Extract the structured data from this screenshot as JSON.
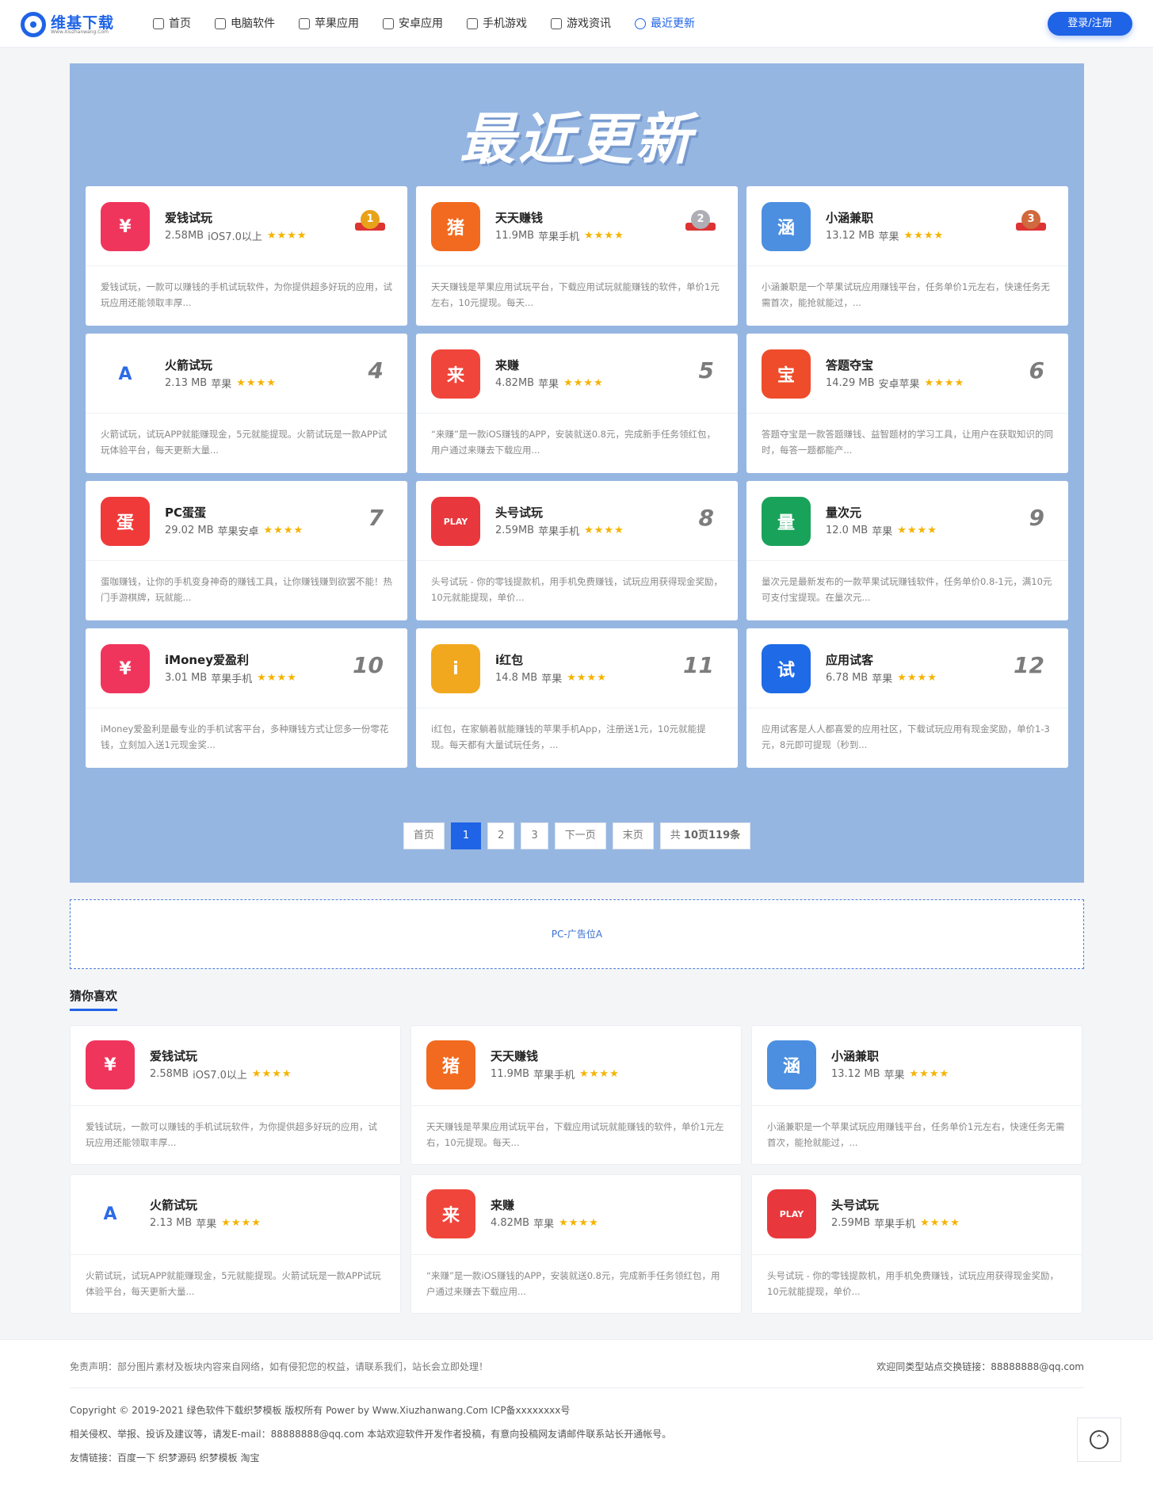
{
  "header": {
    "logo_text": "维基下载",
    "logo_sub": "Www.Xiuzhanwang.Com",
    "nav": [
      {
        "label": "首页",
        "icon": "home-icon"
      },
      {
        "label": "电脑软件",
        "icon": "software-icon"
      },
      {
        "label": "苹果应用",
        "icon": "apple-icon"
      },
      {
        "label": "安卓应用",
        "icon": "android-icon"
      },
      {
        "label": "手机游戏",
        "icon": "game-icon"
      },
      {
        "label": "游戏资讯",
        "icon": "news-icon"
      },
      {
        "label": "最近更新",
        "icon": "update-icon"
      }
    ],
    "login": "登录/注册"
  },
  "hero": {
    "title": "最近更新",
    "cards": [
      {
        "name": "爱钱试玩",
        "size": "2.58MB",
        "platform": "iOS7.0以上",
        "rank": "1",
        "medal": "GOLD",
        "desc": "爱钱试玩，一款可以赚钱的手机试玩软件，为你提供超多好玩的应用，试玩应用还能领取丰厚...",
        "icon_text": "¥",
        "icon_bg": "#f0355d"
      },
      {
        "name": "天天赚钱",
        "size": "11.9MB",
        "platform": "苹果手机",
        "rank": "2",
        "medal": "SILVER",
        "desc": "天天赚钱是苹果应用试玩平台，下载应用试玩就能赚钱的软件，单价1元左右，10元提现。每天...",
        "icon_text": "猪",
        "icon_bg": "#f26a1f"
      },
      {
        "name": "小涵兼职",
        "size": "13.12 MB",
        "platform": "苹果",
        "rank": "3",
        "medal": "BRONZE",
        "desc": "小涵兼职是一个苹果试玩应用赚钱平台，任务单价1元左右，快速任务无需首次，能抢就能过，...",
        "icon_text": "涵",
        "icon_bg": "#4c8fe0"
      },
      {
        "name": "火箭试玩",
        "size": "2.13 MB",
        "platform": "苹果",
        "rank": "4",
        "medal": "",
        "desc": "火箭试玩，试玩APP就能赚现金，5元就能提现。火箭试玩是一款APP试玩体验平台，每天更新大量...",
        "icon_text": "A",
        "icon_bg": "#ffffff"
      },
      {
        "name": "来赚",
        "size": "4.82MB",
        "platform": "苹果",
        "rank": "5",
        "medal": "",
        "desc": "“来赚”是一款iOS赚钱的APP，安装就送0.8元，完成新手任务领红包，用户通过来赚去下载应用...",
        "icon_text": "来",
        "icon_bg": "#f0453b"
      },
      {
        "name": "答题夺宝",
        "size": "14.29 MB",
        "platform": "安卓苹果",
        "rank": "6",
        "medal": "",
        "desc": "答题夺宝是一款答题赚钱、益智题材的学习工具，让用户在获取知识的同时，每答一题都能产...",
        "icon_text": "宝",
        "icon_bg": "#ee4c2a"
      },
      {
        "name": "PC蛋蛋",
        "size": "29.02 MB",
        "platform": "苹果安卓",
        "rank": "7",
        "medal": "",
        "desc": "蛋咖赚钱，让你的手机变身神奇的赚钱工具，让你赚钱赚到欲罢不能！热门手游棋牌，玩就能...",
        "icon_text": "蛋",
        "icon_bg": "#f03a3a"
      },
      {
        "name": "头号试玩",
        "size": "2.59MB",
        "platform": "苹果手机",
        "rank": "8",
        "medal": "",
        "desc": "头号试玩 - 你的零钱提款机，用手机免费赚钱，试玩应用获得现金奖励，10元就能提现，单价...",
        "icon_text": "PLAY",
        "icon_bg": "#e8383d"
      },
      {
        "name": "量次元",
        "size": "12.0 MB",
        "platform": "苹果",
        "rank": "9",
        "medal": "",
        "desc": "量次元是最新发布的一款苹果试玩赚钱软件，任务单价0.8-1元，满10元可支付宝提现。在量次元...",
        "icon_text": "量",
        "icon_bg": "#19a35a"
      },
      {
        "name": "iMoney爱盈利",
        "size": "3.01 MB",
        "platform": "苹果手机",
        "rank": "10",
        "medal": "",
        "desc": "iMoney爱盈利是最专业的手机试客平台，多种赚钱方式让您多一份零花钱，立刻加入送1元现金奖...",
        "icon_text": "¥",
        "icon_bg": "#f0355d"
      },
      {
        "name": "i红包",
        "size": "14.8 MB",
        "platform": "苹果",
        "rank": "11",
        "medal": "",
        "desc": "i红包，在家躺着就能赚钱的苹果手机App，注册送1元，10元就能提现。每天都有大量试玩任务，...",
        "icon_text": "i",
        "icon_bg": "#f2a81e"
      },
      {
        "name": "应用试客",
        "size": "6.78 MB",
        "platform": "苹果",
        "rank": "12",
        "medal": "",
        "desc": "应用试客是人人都喜爱的应用社区，下载试玩应用有现金奖励，单价1-3元，8元即可提现（秒到...",
        "icon_text": "试",
        "icon_bg": "#1f6ae6"
      }
    ]
  },
  "pager": {
    "first": "首页",
    "pages": [
      "1",
      "2",
      "3"
    ],
    "next": "下一页",
    "last": "末页",
    "total_prefix": "共",
    "total_pages": "10页",
    "total_count": "119条"
  },
  "ad": {
    "label": "PC-广告位A"
  },
  "guess": {
    "title": "猜你喜欢",
    "cards": [
      {
        "name": "爱钱试玩",
        "size": "2.58MB",
        "platform": "iOS7.0以上",
        "desc": "爱钱试玩，一款可以赚钱的手机试玩软件，为你提供超多好玩的应用，试玩应用还能领取丰厚...",
        "icon_text": "¥",
        "icon_bg": "#f0355d"
      },
      {
        "name": "天天赚钱",
        "size": "11.9MB",
        "platform": "苹果手机",
        "desc": "天天赚钱是苹果应用试玩平台，下载应用试玩就能赚钱的软件，单价1元左右，10元提现。每天...",
        "icon_text": "猪",
        "icon_bg": "#f26a1f"
      },
      {
        "name": "小涵兼职",
        "size": "13.12 MB",
        "platform": "苹果",
        "desc": "小涵兼职是一个苹果试玩应用赚钱平台，任务单价1元左右，快速任务无需首次，能抢就能过，...",
        "icon_text": "涵",
        "icon_bg": "#4c8fe0"
      },
      {
        "name": "火箭试玩",
        "size": "2.13 MB",
        "platform": "苹果",
        "desc": "火箭试玩，试玩APP就能赚现金，5元就能提现。火箭试玩是一款APP试玩体验平台，每天更新大量...",
        "icon_text": "A",
        "icon_bg": "#ffffff"
      },
      {
        "name": "来赚",
        "size": "4.82MB",
        "platform": "苹果",
        "desc": "“来赚”是一款iOS赚钱的APP，安装就送0.8元，完成新手任务领红包，用户通过来赚去下载应用...",
        "icon_text": "来",
        "icon_bg": "#f0453b"
      },
      {
        "name": "头号试玩",
        "size": "2.59MB",
        "platform": "苹果手机",
        "desc": "头号试玩 - 你的零钱提款机，用手机免费赚钱，试玩应用获得现金奖励，10元就能提现，单价...",
        "icon_text": "PLAY",
        "icon_bg": "#e8383d"
      }
    ]
  },
  "footer": {
    "disclaimer": "免责声明：部分图片素材及板块内容来自网络，如有侵犯您的权益，请联系我们，站长会立即处理！",
    "exchange": "欢迎同类型站点交换链接：88888888@qq.com",
    "copyright": "Copyright © 2019-2021 绿色软件下载织梦模板 版权所有 Power by Www.Xiuzhanwang.Com     ICP备xxxxxxxx号",
    "report": "相关侵权、举报、投诉及建议等，请发E-mail：88888888@qq.com 本站欢迎软件开发作者投稿，有意向投稿网友请邮件联系站长开通帐号。",
    "links": "友情链接：百度一下 织梦源码 织梦模板 淘宝"
  },
  "colors": {
    "accent": "#1f63e6",
    "hero_bg": "#96b6e2",
    "star": "#f5b301"
  }
}
